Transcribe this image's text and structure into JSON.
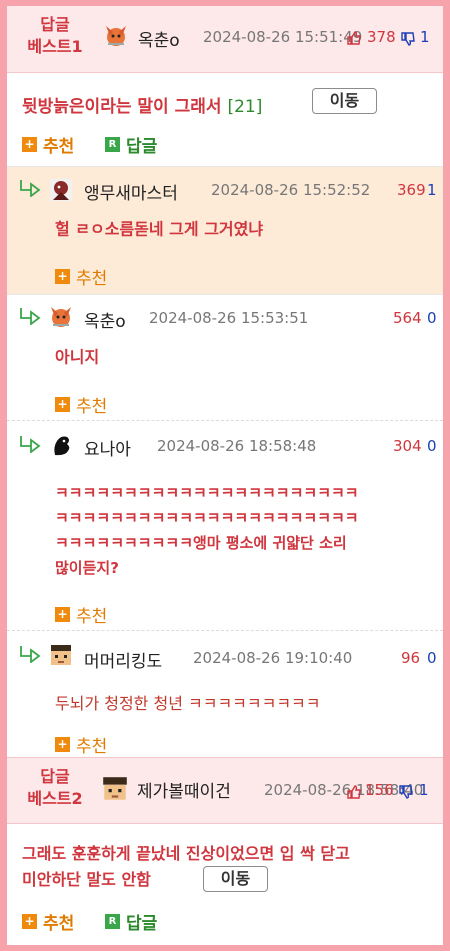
{
  "best1": {
    "badge_line1": "답글",
    "badge_line2": "베스트1",
    "nick": "옥춘o",
    "date": "2024-08-26 15:51:49",
    "up": "378",
    "down": "1",
    "title": "뒷방늙은이라는 말이 그래서",
    "comment_count": "[21]",
    "move_label": "이동",
    "recommend_label": "추천",
    "reply_label": "답글"
  },
  "replies": [
    {
      "nick": "앵무새마스터",
      "date": "2024-08-26 15:52:52",
      "up": "369",
      "down": "1",
      "text": "헐 ㄹㅇ소름돋네 그게 그거였냐",
      "recommend_label": "추천"
    },
    {
      "nick": "옥춘o",
      "date": "2024-08-26 15:53:51",
      "up": "564",
      "down": "0",
      "text": "아니지",
      "recommend_label": "추천"
    },
    {
      "nick": "요나아",
      "date": "2024-08-26 18:58:48",
      "up": "304",
      "down": "0",
      "text_lines": [
        "ㅋㅋㅋㅋㅋㅋㅋㅋㅋㅋㅋㅋㅋㅋㅋㅋㅋㅋㅋㅋㅋㅋ",
        "ㅋㅋㅋㅋㅋㅋㅋㅋㅋㅋㅋㅋㅋㅋㅋㅋㅋㅋㅋㅋㅋㅋ",
        "ㅋㅋㅋㅋㅋㅋㅋㅋㅋㅋ앵마 평소에 귀얇단 소리",
        "많이듣지?"
      ],
      "recommend_label": "추천"
    },
    {
      "nick": "머머리킹도",
      "date": "2024-08-26 19:10:40",
      "up": "96",
      "down": "0",
      "text": "두뇌가 청정한 청년 ㅋㅋㅋㅋㅋㅋㅋㅋㅋ",
      "recommend_label": "추천"
    }
  ],
  "best2": {
    "badge_line1": "답글",
    "badge_line2": "베스트2",
    "nick": "제가볼때이건",
    "date": "2024-08-26 18:58:40",
    "up": "156",
    "down": "1",
    "text_line1": "그래도 훈훈하게 끝났네 진상이었으면 입 싹 닫고",
    "text_line2": "미안하단 말도 안함",
    "move_label": "이동",
    "recommend_label": "추천",
    "reply_label": "답글"
  },
  "colors": {
    "accent_red": "#d0363e",
    "count_blue": "#1d3fb8",
    "pink_bg": "#fde8ea",
    "highlight_bg": "#fdebd8",
    "orange": "#ef8a0c",
    "green": "#3aa64a"
  }
}
